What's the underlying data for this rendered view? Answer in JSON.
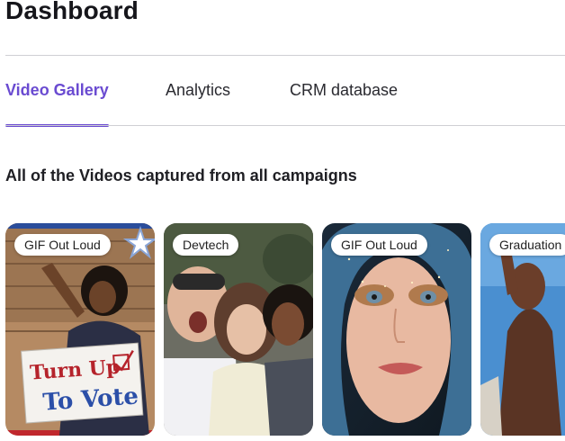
{
  "page": {
    "title": "Dashboard"
  },
  "tabs": [
    {
      "label": "Video Gallery",
      "active": true
    },
    {
      "label": "Analytics",
      "active": false
    },
    {
      "label": "CRM database",
      "active": false
    }
  ],
  "section": {
    "title": "All of the Videos captured from all campaigns"
  },
  "videos": [
    {
      "tag": "GIF Out Loud",
      "sign_line1": "Turn Up",
      "sign_line2": "To Vote"
    },
    {
      "tag": "Devtech"
    },
    {
      "tag": "GIF Out Loud"
    },
    {
      "tag": "Graduation"
    }
  ],
  "colors": {
    "accent": "#6a4bd1",
    "divider": "#cfcfd4"
  }
}
